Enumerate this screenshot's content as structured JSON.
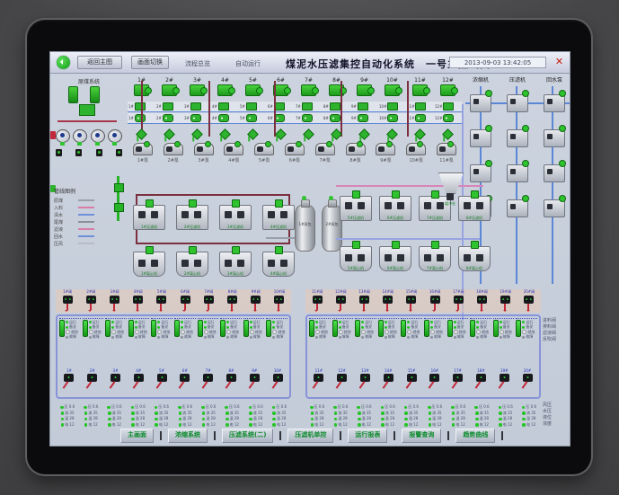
{
  "window": {
    "nav_back": "返回主图",
    "nav_menu": "画面切换",
    "status1": "流程总览",
    "status2": "自动运行",
    "title": "煤泥水压滤集控自动化系统",
    "subtitle": "一号主控画面",
    "datetime": "2013-09-03 13:42:05",
    "close": "✕"
  },
  "top": {
    "left_group_label": "原煤系统",
    "columns": [
      "1#",
      "2#",
      "3#",
      "4#",
      "5#",
      "6#",
      "7#",
      "8#",
      "9#",
      "10#",
      "11#",
      "12#"
    ],
    "pumps": [
      "1#泵",
      "2#泵",
      "3#泵",
      "4#泵",
      "5#泵",
      "6#泵",
      "7#泵",
      "8#泵",
      "9#泵",
      "10#泵",
      "11#泵"
    ],
    "right_headers": [
      "浓缩机",
      "压滤机",
      "回水泵"
    ]
  },
  "legend": {
    "title": "管线图例",
    "items": [
      {
        "label": "原煤",
        "color": "#9aa0aa"
      },
      {
        "label": "入料",
        "color": "#d87ca8"
      },
      {
        "label": "清水",
        "color": "#6f8fd8"
      },
      {
        "label": "尾煤",
        "color": "#8a8f98"
      },
      {
        "label": "滤液",
        "color": "#d87ca8"
      },
      {
        "label": "回水",
        "color": "#6f8fd8"
      },
      {
        "label": "压风",
        "color": "#b8bcc4"
      }
    ]
  },
  "mid": {
    "left_row1": [
      "1#压滤机",
      "2#压滤机",
      "3#压滤机",
      "4#压滤机"
    ],
    "left_row2": [
      "1#离心机",
      "2#离心机",
      "3#离心机",
      "4#离心机"
    ],
    "tanks": [
      "1#风包",
      "2#风包"
    ],
    "right_row1": [
      "5#压滤机",
      "6#压滤机",
      "7#压滤机",
      "8#压滤机"
    ],
    "right_row2": [
      "5#离心机",
      "6#离心机",
      "7#离心机",
      "8#离心机"
    ],
    "hopper_label": "缓冲仓"
  },
  "bottom": {
    "left": {
      "valves1": [
        "1#阀",
        "2#阀",
        "3#阀",
        "4#阀",
        "5#阀",
        "6#阀",
        "7#阀",
        "8#阀",
        "9#阀",
        "10#阀"
      ],
      "valves2": [
        "1#",
        "2#",
        "3#",
        "4#",
        "5#",
        "6#",
        "7#",
        "8#",
        "9#",
        "10#"
      ]
    },
    "right": {
      "valves1": [
        "11#阀",
        "12#阀",
        "13#阀",
        "14#阀",
        "15#阀",
        "16#阀",
        "17#阀",
        "18#阀",
        "19#阀",
        "20#阀"
      ],
      "valves2": [
        "11#",
        "12#",
        "13#",
        "14#",
        "15#",
        "16#",
        "17#",
        "18#",
        "19#",
        "20#"
      ]
    },
    "cell_lines": [
      "运行",
      "备妥",
      "就地",
      "故障"
    ],
    "grid_lines": [
      "压 0.6",
      "流 35",
      "温 28",
      "电 12"
    ],
    "notes1": [
      "进料阀",
      "排料阀",
      "滤液阀",
      "反吹阀"
    ],
    "notes2": [
      "风压",
      "水压",
      "液位",
      "浓度"
    ]
  },
  "buttons": [
    "主画面",
    "浓缩系统",
    "压滤系统(二)",
    "压滤机单控",
    "运行报表",
    "报警查询",
    "趋势曲线"
  ]
}
